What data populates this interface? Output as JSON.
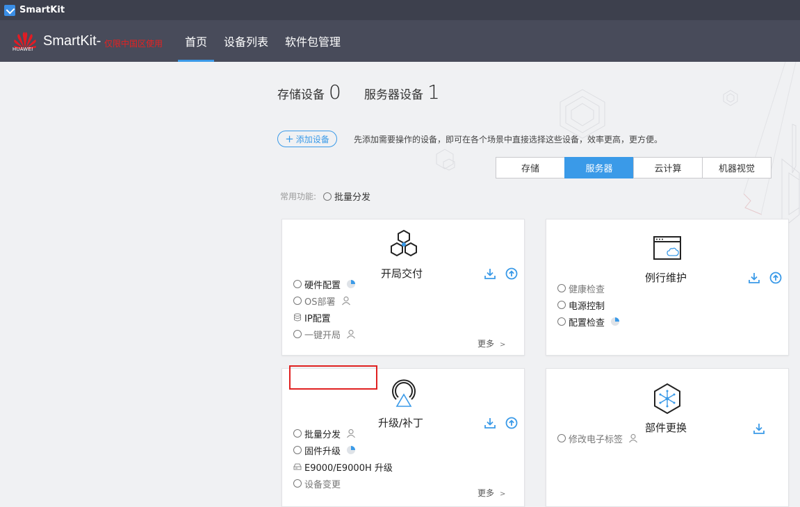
{
  "titlebar": {
    "app_name": "SmartKit"
  },
  "header": {
    "logo_text": "HUAWEI",
    "brand": "SmartKit-",
    "brand_note": "仅限中国区使用",
    "nav": [
      {
        "label": "首页",
        "active": true
      },
      {
        "label": "设备列表",
        "active": false
      },
      {
        "label": "软件包管理",
        "active": false
      }
    ]
  },
  "stats": {
    "storage_label": "存储设备",
    "storage_count": "0",
    "server_label": "服务器设备",
    "server_count": "1"
  },
  "add_device": {
    "label": "添加设备",
    "hint": "先添加需要操作的设备，即可在各个场景中直接选择这些设备，效率更高，更方便。"
  },
  "tabs": [
    "存储",
    "服务器",
    "云计算",
    "机器视觉"
  ],
  "active_tab": "服务器",
  "common_functions": {
    "label": "常用功能:",
    "item": "批量分发"
  },
  "cards": {
    "deploy": {
      "title": "开局交付",
      "items": [
        "硬件配置",
        "OS部署",
        "IP配置",
        "一键开局"
      ],
      "more": "更多"
    },
    "maintenance": {
      "title": "例行维护",
      "items": [
        "健康检查",
        "电源控制",
        "配置检查"
      ]
    },
    "upgrade": {
      "title": "升级/补丁",
      "items": [
        "批量分发",
        "固件升级",
        "E9000/E9000H 升级",
        "设备变更"
      ],
      "more": "更多"
    },
    "replace": {
      "title": "部件更换",
      "items": [
        "修改电子标签"
      ]
    }
  },
  "colors": {
    "accent": "#3a9ae8",
    "titlebar": "#3d404d",
    "header": "#484b5a",
    "highlight": "#e02020"
  }
}
